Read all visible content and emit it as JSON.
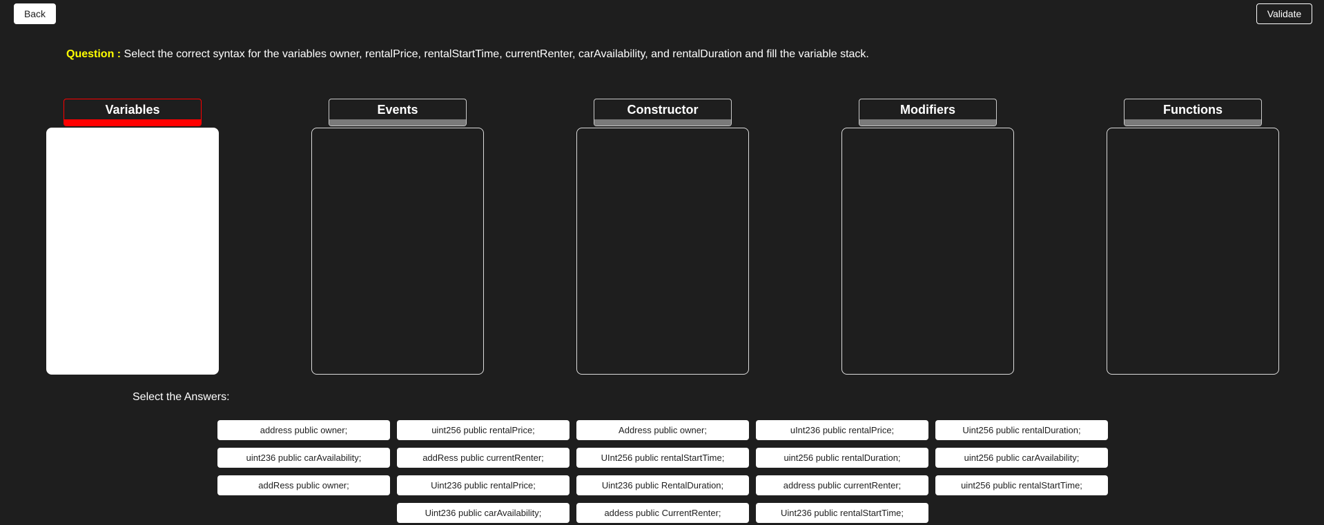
{
  "toolbar": {
    "back_label": "Back",
    "validate_label": "Validate"
  },
  "question": {
    "label": "Question :",
    "text": " Select the correct syntax for the variables owner, rentalPrice, rentalStartTime, currentRenter, carAvailability, and rentalDuration and fill the variable stack."
  },
  "categories": [
    {
      "label": "Variables",
      "active": true
    },
    {
      "label": "Events",
      "active": false
    },
    {
      "label": "Constructor",
      "active": false
    },
    {
      "label": "Modifiers",
      "active": false
    },
    {
      "label": "Functions",
      "active": false
    }
  ],
  "colors": {
    "background": "#1e1e1e",
    "active_accent": "#ff0000",
    "inactive_bar": "#7a7a7a",
    "question_label": "#ffff00"
  },
  "answers_label": "Select the Answers:",
  "answers": [
    [
      "address public owner;",
      "uint256 public rentalPrice;",
      "Address public owner;",
      "uInt236 public rentalPrice;",
      "Uint256 public rentalDuration;"
    ],
    [
      "uint236 public carAvailability;",
      "addRess public currentRenter;",
      "UInt256 public rentalStartTime;",
      "uint256 public rentalDuration;",
      "uint256 public carAvailability;"
    ],
    [
      "addRess public owner;",
      "Uint236 public rentalPrice;",
      "Uint236 public RentalDuration;",
      "address public currentRenter;",
      "uint256 public rentalStartTime;"
    ],
    [
      "",
      "Uint236 public carAvailability;",
      "addess public CurrentRenter;",
      "Uint236 public rentalStartTime;",
      ""
    ]
  ]
}
